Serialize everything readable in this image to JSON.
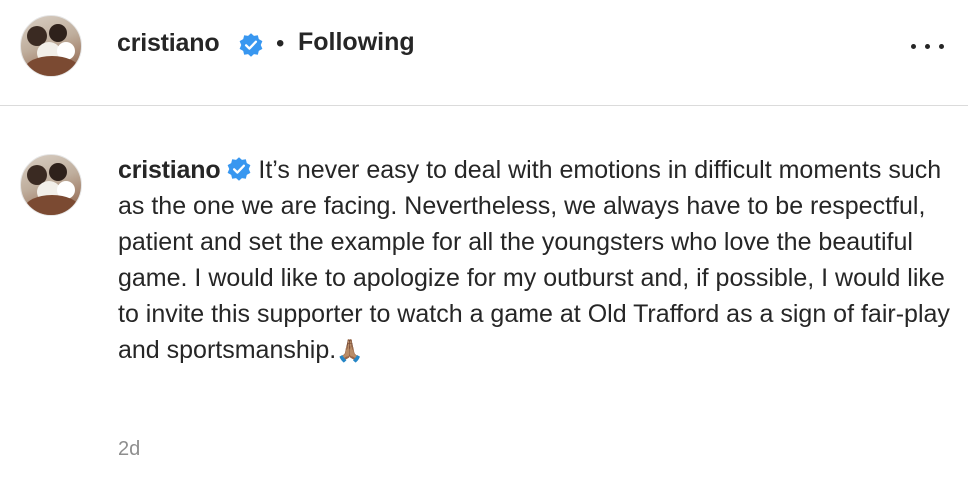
{
  "post": {
    "username": "cristiano",
    "separator": "•",
    "follow_status": "Following",
    "more_icon": "more-horizontal-icon"
  },
  "comment": {
    "username": "cristiano",
    "text": "It’s never easy to deal with emotions in difficult moments such as the one we are facing. Nevertheless, we always have to be respectful, patient and set the example for all the youngsters who love the beautiful game. I would like to apologize for my outburst and, if possible, I would like to invite this supporter to watch a game at Old Trafford as a sign of fair-play and sportsmanship.",
    "emoji": "🙏🏽",
    "time": "2d"
  },
  "colors": {
    "text": "#262626",
    "muted": "#8e8e8e",
    "verified": "#3897f0",
    "divider": "#dbdbdb"
  }
}
